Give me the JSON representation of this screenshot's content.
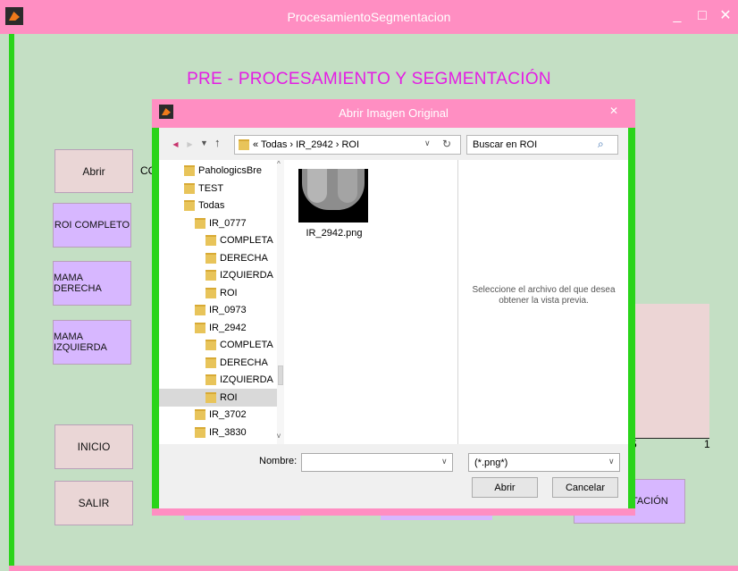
{
  "app": {
    "title": "ProcesamientoSegmentacion",
    "heading": "PRE - PROCESAMIENTO    Y   SEGMENTACIÓN",
    "partial_label": "CO",
    "bg_color": "#c4dfc4",
    "accent_color": "#ff8ec2",
    "border_color": "#2ad41a"
  },
  "window_controls": {
    "minimize": "_",
    "maximize": "□",
    "close": "✕"
  },
  "buttons": {
    "abrir": "Abrir",
    "roi_completo": "ROI COMPLETO",
    "mama_derecha": "MAMA DERECHA",
    "mama_izquierda": "MAMA IZQUIERDA",
    "inicio": "INICIO",
    "salir": "SALIR",
    "segmentacion_partial": "TACIÓN"
  },
  "axis": {
    "tick_half": "5",
    "tick_one": "1"
  },
  "dialog": {
    "title": "Abrir Imagen Original",
    "close": "✕",
    "breadcrumb": "«  Todas  ›  IR_2942  ›  ROI",
    "search_placeholder": "Buscar en ROI",
    "tree": [
      {
        "label": "PahologicsBre",
        "indent": 0
      },
      {
        "label": "TEST",
        "indent": 0
      },
      {
        "label": "Todas",
        "indent": 0
      },
      {
        "label": "IR_0777",
        "indent": 1
      },
      {
        "label": "COMPLETA",
        "indent": 2
      },
      {
        "label": "DERECHA",
        "indent": 2
      },
      {
        "label": "IZQUIERDA",
        "indent": 2
      },
      {
        "label": "ROI",
        "indent": 2
      },
      {
        "label": "IR_0973",
        "indent": 1
      },
      {
        "label": "IR_2942",
        "indent": 1
      },
      {
        "label": "COMPLETA",
        "indent": 2
      },
      {
        "label": "DERECHA",
        "indent": 2
      },
      {
        "label": "IZQUIERDA",
        "indent": 2
      },
      {
        "label": "ROI",
        "indent": 2,
        "selected": true
      },
      {
        "label": "IR_3702",
        "indent": 1
      },
      {
        "label": "IR_3830",
        "indent": 1
      }
    ],
    "file": {
      "name": "IR_2942.png"
    },
    "preview_text": "Seleccione el archivo del que desea obtener la vista previa.",
    "nombre_label": "Nombre:",
    "nombre_value": "",
    "filter_value": "(*.png*)",
    "open_button": "Abrir",
    "cancel_button": "Cancelar"
  }
}
